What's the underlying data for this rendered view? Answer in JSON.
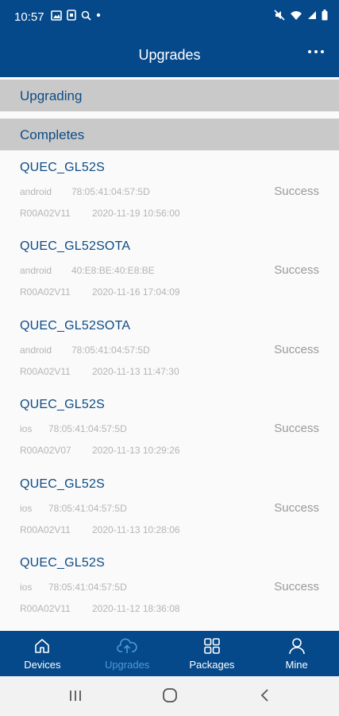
{
  "status_bar": {
    "time": "10:57"
  },
  "app_bar": {
    "title": "Upgrades"
  },
  "sections": {
    "upgrading": "Upgrading",
    "completes": "Completes"
  },
  "records": [
    {
      "name": "QUEC_GL52S",
      "platform": "android",
      "mac": "78:05:41:04:57:5D",
      "status": "Success",
      "version": "R00A02V11",
      "time": "2020-11-19 10:56:00"
    },
    {
      "name": "QUEC_GL52SOTA",
      "platform": "android",
      "mac": "40:E8:BE:40:E8:BE",
      "status": "Success",
      "version": "R00A02V11",
      "time": "2020-11-16 17:04:09"
    },
    {
      "name": "QUEC_GL52SOTA",
      "platform": "android",
      "mac": "78:05:41:04:57:5D",
      "status": "Success",
      "version": "R00A02V11",
      "time": "2020-11-13 11:47:30"
    },
    {
      "name": "QUEC_GL52S",
      "platform": "ios",
      "mac": "78:05:41:04:57:5D",
      "status": "Success",
      "version": "R00A02V07",
      "time": "2020-11-13 10:29:26"
    },
    {
      "name": "QUEC_GL52S",
      "platform": "ios",
      "mac": "78:05:41:04:57:5D",
      "status": "Success",
      "version": "R00A02V11",
      "time": "2020-11-13 10:28:06"
    },
    {
      "name": "QUEC_GL52S",
      "platform": "ios",
      "mac": "78:05:41:04:57:5D",
      "status": "Success",
      "version": "R00A02V11",
      "time": "2020-11-12 18:36:08"
    }
  ],
  "bottom_nav": [
    {
      "label": "Devices",
      "icon": "home-icon",
      "active": false
    },
    {
      "label": "Upgrades",
      "icon": "cloud-upload-icon",
      "active": true
    },
    {
      "label": "Packages",
      "icon": "grid-icon",
      "active": false
    },
    {
      "label": "Mine",
      "icon": "person-icon",
      "active": false
    }
  ],
  "colors": {
    "primary": "#05498a",
    "active_tab": "#4c9bd8",
    "section_bg": "#c9c9c9",
    "title_text": "#0d4c86"
  }
}
